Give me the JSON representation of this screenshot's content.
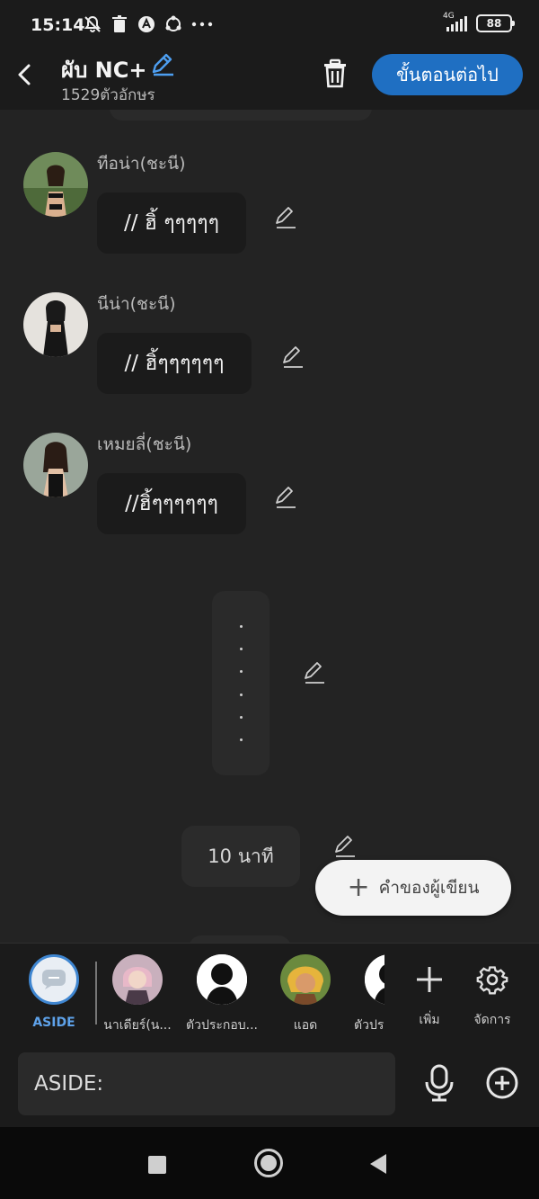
{
  "status_bar": {
    "time": "15:14",
    "network": "4G",
    "battery": "88",
    "icons": [
      "bell-off-icon",
      "trash-status-icon",
      "app-a-icon",
      "sync-icon",
      "more-dots-icon"
    ]
  },
  "header": {
    "title": "ผับ NC+",
    "char_count": "1529ตัวอักษร",
    "next_button": "ขั้นตอนต่อไป"
  },
  "messages": [
    {
      "name": "ทีอน่า(ชะนี)",
      "text": "// ฮิ้ ๆๆๆๆๆ"
    },
    {
      "name": "นีน่า(ชะนี)",
      "text": "// ฮิ้ๆๆๆๆๆๆ"
    },
    {
      "name": "เหมยลี่(ชะนี)",
      "text": "//ฮิ้ๆๆๆๆๆๆ"
    }
  ],
  "time_chip": "10 นาที",
  "author_button": "คำของผู้เขียน",
  "characters": [
    {
      "label": "ASIDE"
    },
    {
      "label": "นาเดียร์(น..."
    },
    {
      "label": "ตัวประกอบ..."
    },
    {
      "label": "แอด"
    },
    {
      "label": "ตัวปร"
    }
  ],
  "tools": {
    "add_label": "เพิ่ม",
    "manage_label": "จัดการ"
  },
  "input": {
    "placeholder": "ASIDE:"
  },
  "colors": {
    "accent": "#1f6fc2",
    "background": "#232323",
    "bubble": "#1b1b1b"
  }
}
